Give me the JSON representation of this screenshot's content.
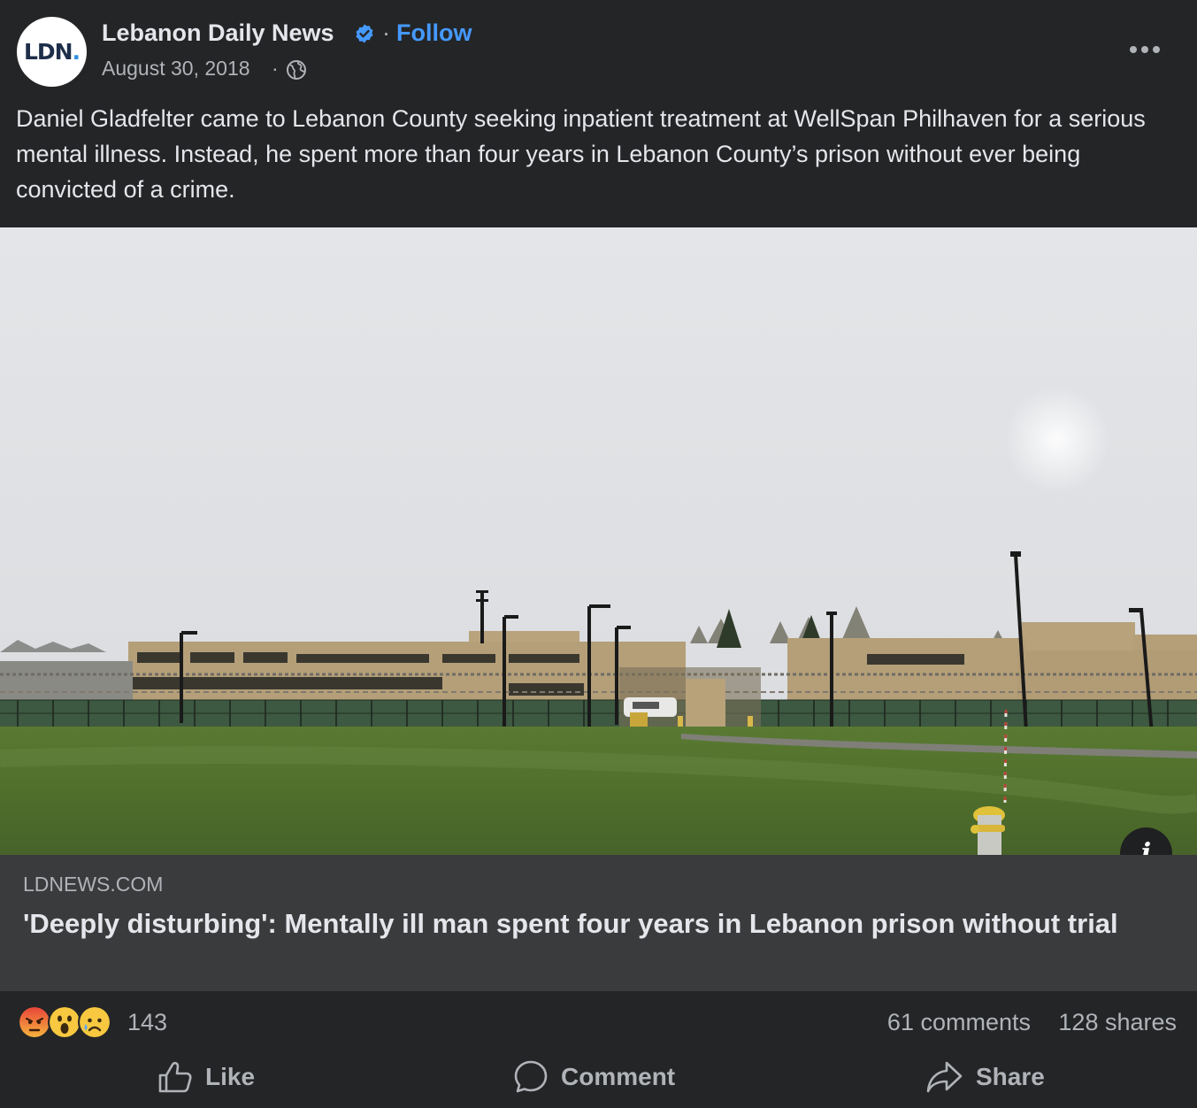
{
  "post": {
    "page_name": "Lebanon Daily News",
    "avatar_text": "LDN",
    "avatar_dot": ".",
    "follow_sep": "·",
    "follow_label": "Follow",
    "date": "August 30, 2018",
    "date_sep": "·",
    "privacy_icon": "globe-icon",
    "body": "Daniel Gladfelter came to Lebanon County seeking inpatient treatment at WellSpan Philhaven for a serious mental illness. Instead, he spent more than four years in Lebanon County’s prison without ever being convicted of a crime."
  },
  "link": {
    "domain": "LDNEWS.COM",
    "headline": "'Deeply disturbing': Mentally ill man spent four years in Lebanon prison without trial",
    "info_label": "i"
  },
  "stats": {
    "reactions": [
      "angry",
      "wow",
      "sad"
    ],
    "reaction_count": "143",
    "comments": "61 comments",
    "shares": "128 shares"
  },
  "actions": {
    "like": "Like",
    "comment": "Comment",
    "share": "Share"
  },
  "colors": {
    "background": "#242526",
    "link_box": "#3a3b3c",
    "accent": "#4599ff",
    "text_primary": "#e4e6eb",
    "text_secondary": "#b0b3b8"
  }
}
